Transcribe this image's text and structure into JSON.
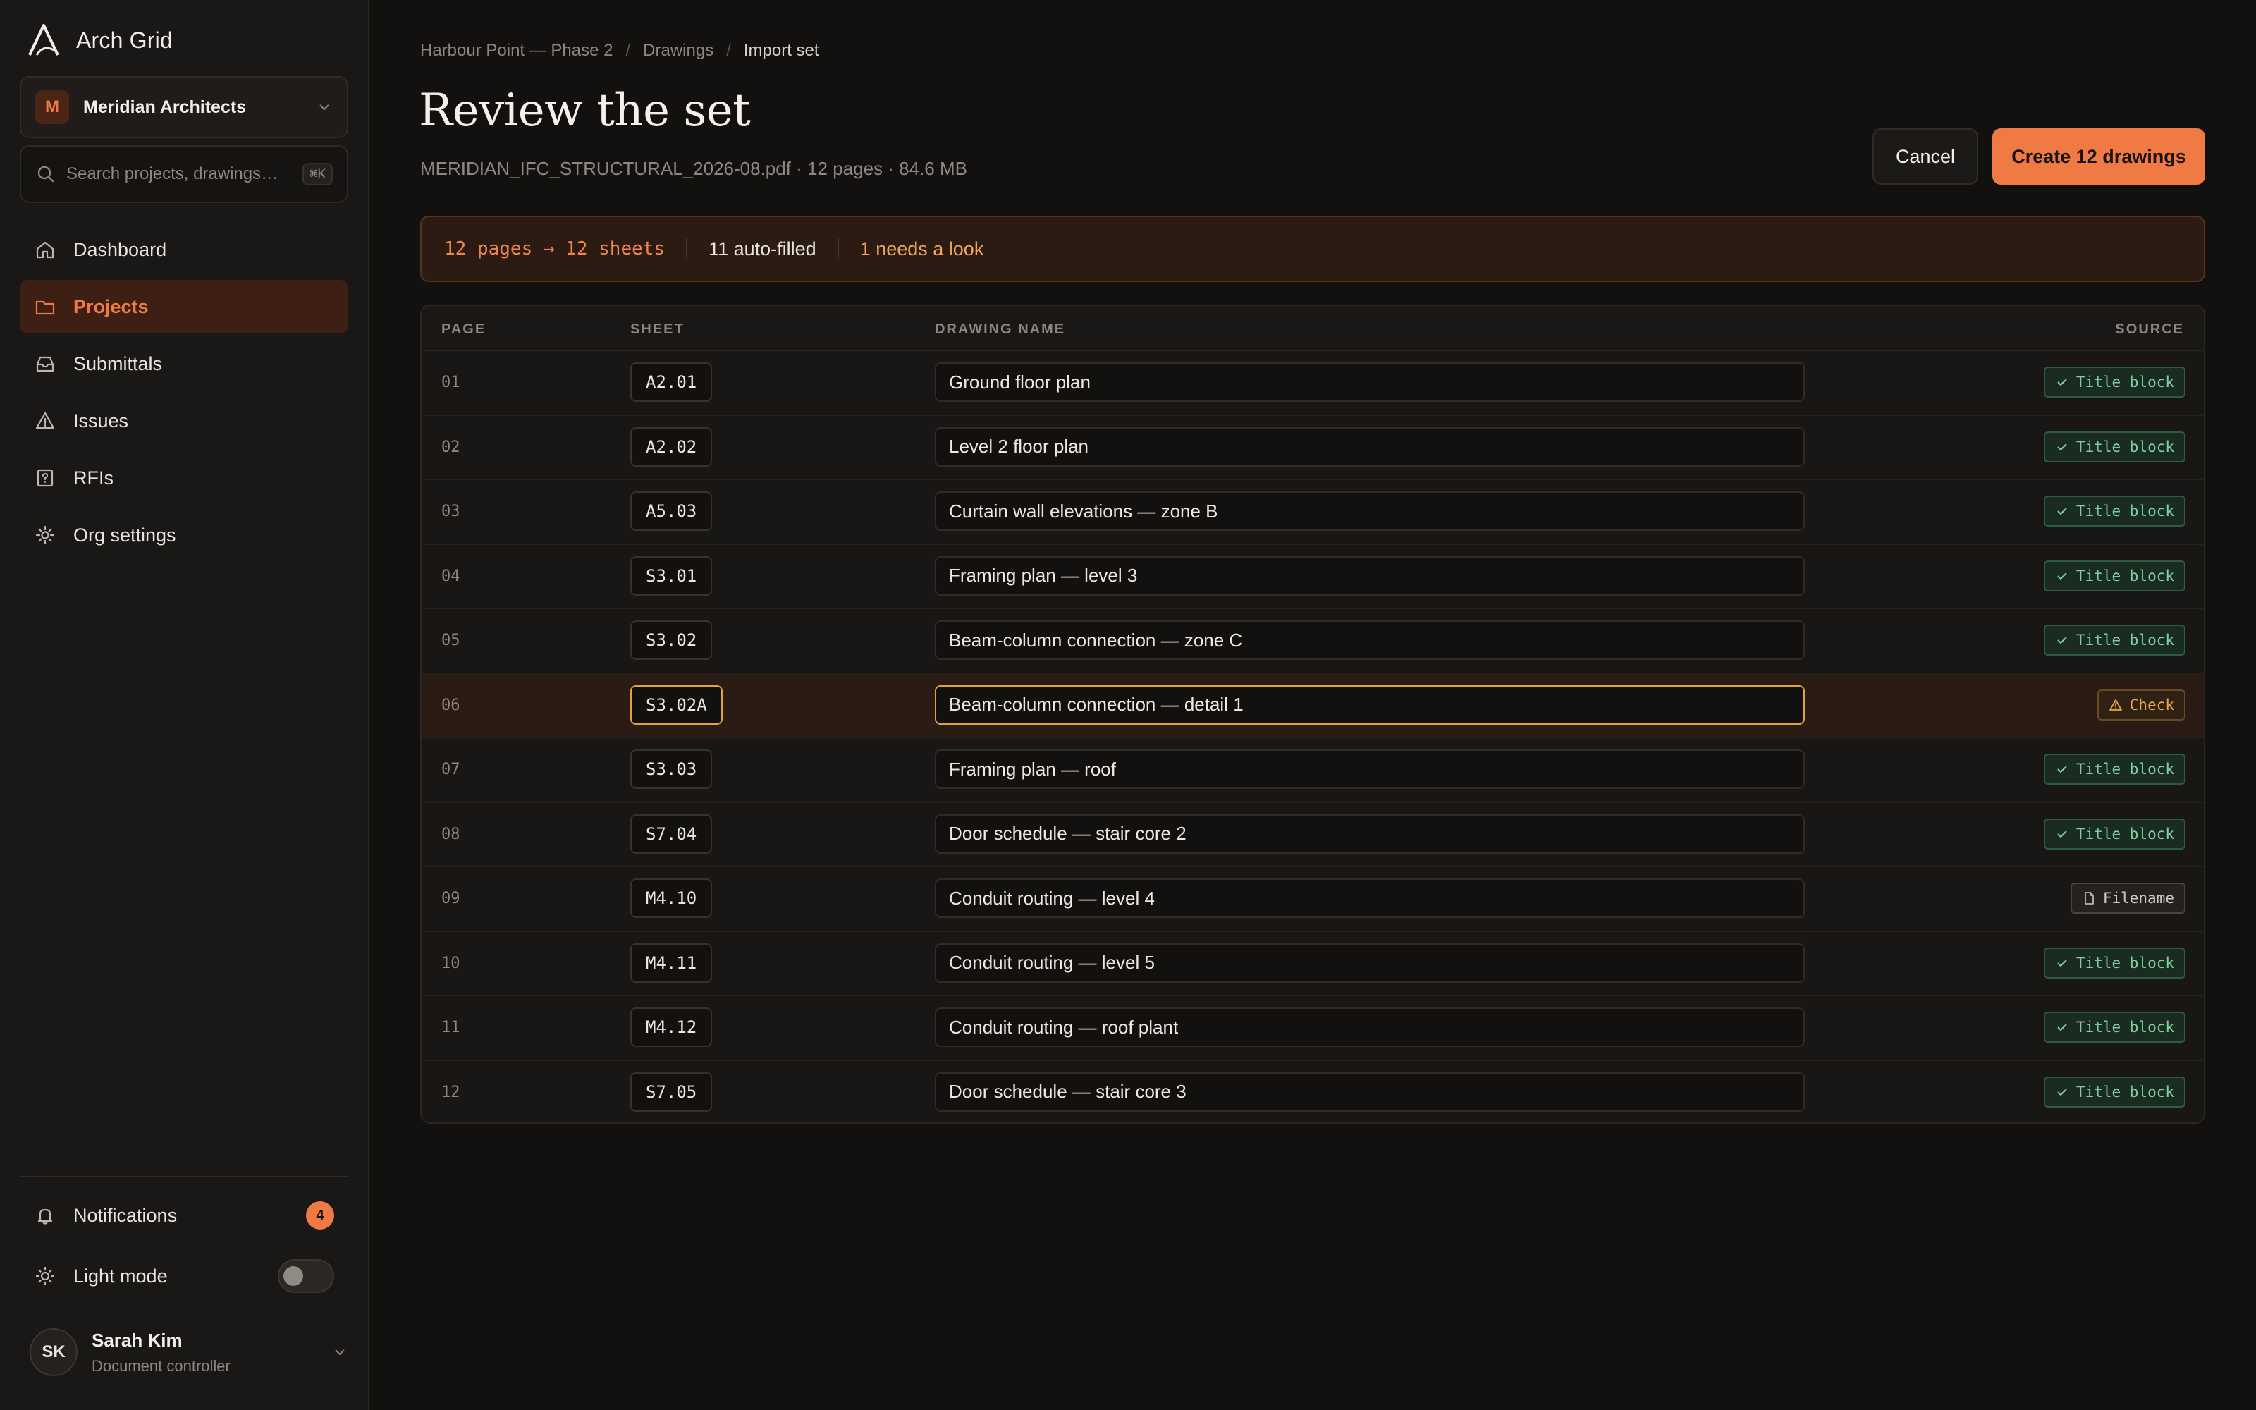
{
  "app": {
    "name": "Arch Grid"
  },
  "org": {
    "name": "Meridian Architects",
    "initial": "M"
  },
  "search": {
    "placeholder": "Search projects, drawings…",
    "shortcut": "⌘K"
  },
  "nav": [
    {
      "label": "Dashboard",
      "icon": "home-icon",
      "active": false
    },
    {
      "label": "Projects",
      "icon": "folder-icon",
      "active": true
    },
    {
      "label": "Submittals",
      "icon": "inbox-icon",
      "active": false
    },
    {
      "label": "Issues",
      "icon": "warning-icon",
      "active": false
    },
    {
      "label": "RFIs",
      "icon": "question-icon",
      "active": false
    },
    {
      "label": "Org settings",
      "icon": "gear-icon",
      "active": false
    }
  ],
  "notifications": {
    "label": "Notifications",
    "count": "4"
  },
  "theme": {
    "label": "Light mode",
    "on": false
  },
  "user": {
    "initials": "SK",
    "name": "Sarah Kim",
    "role": "Document controller"
  },
  "breadcrumb": [
    "Harbour Point — Phase 2",
    "Drawings",
    "Import set"
  ],
  "page": {
    "title": "Review the set",
    "file_meta": "MERIDIAN_IFC_STRUCTURAL_2026-08.pdf · 12 pages · 84.6 MB"
  },
  "actions": {
    "cancel": "Cancel",
    "create": "Create 12 drawings"
  },
  "summary": {
    "mapping": "12 pages → 12 sheets",
    "auto": "11 auto-filled",
    "look": "1 needs a look"
  },
  "table": {
    "headers": {
      "page": "PAGE",
      "sheet": "SHEET",
      "name": "DRAWING NAME",
      "source": "SOURCE"
    },
    "rows": [
      {
        "page": "01",
        "sheet": "A2.01",
        "name": "Ground floor plan",
        "source": "Title block",
        "status": "ok"
      },
      {
        "page": "02",
        "sheet": "A2.02",
        "name": "Level 2 floor plan",
        "source": "Title block",
        "status": "ok"
      },
      {
        "page": "03",
        "sheet": "A5.03",
        "name": "Curtain wall elevations — zone B",
        "source": "Title block",
        "status": "ok"
      },
      {
        "page": "04",
        "sheet": "S3.01",
        "name": "Framing plan — level 3",
        "source": "Title block",
        "status": "ok"
      },
      {
        "page": "05",
        "sheet": "S3.02",
        "name": "Beam-column connection — zone C",
        "source": "Title block",
        "status": "ok"
      },
      {
        "page": "06",
        "sheet": "S3.02A",
        "name": "Beam-column connection — detail 1",
        "source": "Check",
        "status": "check"
      },
      {
        "page": "07",
        "sheet": "S3.03",
        "name": "Framing plan — roof",
        "source": "Title block",
        "status": "ok"
      },
      {
        "page": "08",
        "sheet": "S7.04",
        "name": "Door schedule — stair core 2",
        "source": "Title block",
        "status": "ok"
      },
      {
        "page": "09",
        "sheet": "M4.10",
        "name": "Conduit routing — level 4",
        "source": "Filename",
        "status": "file"
      },
      {
        "page": "10",
        "sheet": "M4.11",
        "name": "Conduit routing — level 5",
        "source": "Title block",
        "status": "ok"
      },
      {
        "page": "11",
        "sheet": "M4.12",
        "name": "Conduit routing — roof plant",
        "source": "Title block",
        "status": "ok"
      },
      {
        "page": "12",
        "sheet": "S7.05",
        "name": "Door schedule — stair core 3",
        "source": "Title block",
        "status": "ok"
      }
    ]
  },
  "colors": {
    "accent": "#ef7a43",
    "ok": "#7fcf9e",
    "warn": "#e8a54a",
    "background": "#121110"
  }
}
